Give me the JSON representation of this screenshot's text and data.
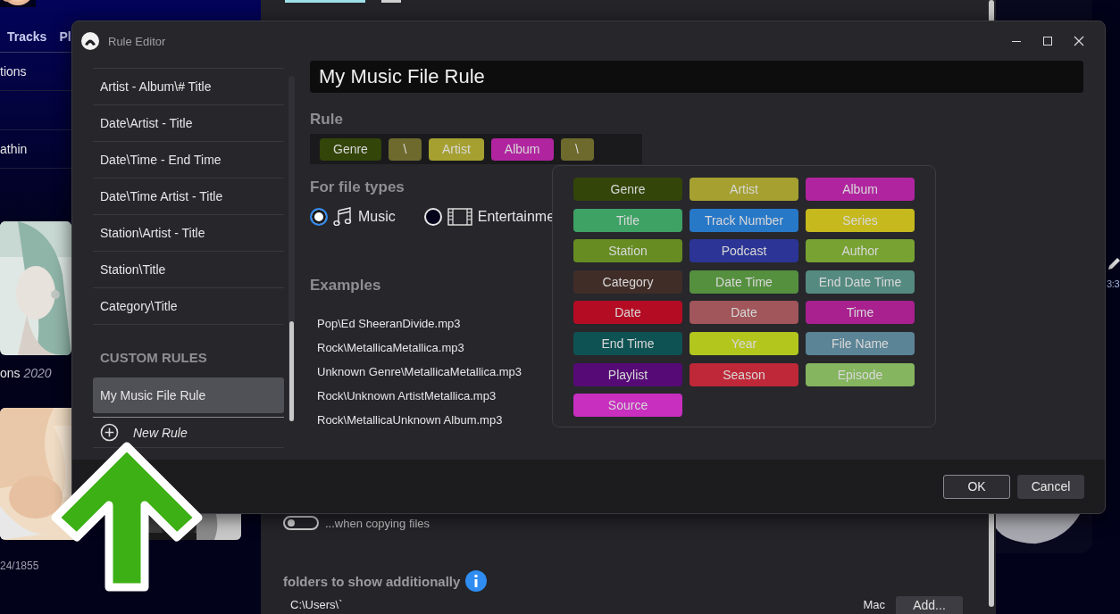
{
  "background_app": {
    "nav_tabs": [
      "Tracks",
      "Pl"
    ],
    "list_items": [
      "tions",
      "athin"
    ],
    "album_caption": {
      "title": "ons",
      "year": "2020"
    },
    "track_count": "24/1855",
    "copy_toggle": {
      "label": "...when copying files",
      "on": false
    },
    "folders": {
      "heading": "folders to show additionally",
      "path": "C:\\Users\\`",
      "column_2": "Mac",
      "add_button": "Add..."
    },
    "time": "3:3"
  },
  "dialog": {
    "title": "Rule Editor",
    "rules": [
      {
        "label": "Artist - Album\\# Title",
        "selected": false
      },
      {
        "label": "Date\\Artist - Title",
        "selected": false
      },
      {
        "label": "Date\\Time - End Time",
        "selected": false
      },
      {
        "label": "Date\\Time Artist - Title",
        "selected": false
      },
      {
        "label": "Station\\Artist - Title",
        "selected": false
      },
      {
        "label": "Station\\Title",
        "selected": false
      },
      {
        "label": "Category\\Title",
        "selected": false
      }
    ],
    "custom_heading": "CUSTOM RULES",
    "custom_rules": [
      {
        "label": "My Music File Rule",
        "selected": true
      }
    ],
    "new_rule": "New Rule",
    "name": "My Music File Rule",
    "rule_heading": "Rule",
    "rule_tokens": [
      {
        "label": "Genre",
        "color": "#334509"
      },
      {
        "label": "\\",
        "color": "#6e6a2e"
      },
      {
        "label": "Artist",
        "color": "#a5a030"
      },
      {
        "label": "Album",
        "color": "#b0259f"
      },
      {
        "label": "\\",
        "color": "#6e6a2e"
      }
    ],
    "file_types_heading": "For file types",
    "file_types": [
      {
        "label": "Music",
        "selected": true,
        "kind": "music"
      },
      {
        "label": "Entertainme",
        "selected": false,
        "kind": "video"
      }
    ],
    "examples_heading": "Examples",
    "examples": [
      "Pop\\Ed SheeranDivide.mp3",
      "Rock\\MetallicaMetallica.mp3",
      "Unknown Genre\\MetallicaMetallica.mp3",
      "Rock\\Unknown ArtistMetallica.mp3",
      "Rock\\MetallicaUnknown Album.mp3"
    ],
    "token_palette": [
      {
        "label": "Genre",
        "color": "#334509"
      },
      {
        "label": "Artist",
        "color": "#a5a030"
      },
      {
        "label": "Album",
        "color": "#b0259f"
      },
      {
        "label": "Title",
        "color": "#3ea265"
      },
      {
        "label": "Track Number",
        "color": "#2878c8"
      },
      {
        "label": "Series",
        "color": "#c6b91e"
      },
      {
        "label": "Station",
        "color": "#668c22"
      },
      {
        "label": "Podcast",
        "color": "#2c3596"
      },
      {
        "label": "Author",
        "color": "#78a232"
      },
      {
        "label": "Category",
        "color": "#412d28"
      },
      {
        "label": "Date Time",
        "color": "#55903f"
      },
      {
        "label": "End Date Time",
        "color": "#558a80"
      },
      {
        "label": "Date",
        "color": "#b40c23"
      },
      {
        "label": "Date",
        "color": "#a0565a"
      },
      {
        "label": "Time",
        "color": "#a9208f"
      },
      {
        "label": "End Time",
        "color": "#0f5253"
      },
      {
        "label": "Year",
        "color": "#b3c61e"
      },
      {
        "label": "File Name",
        "color": "#5b8496"
      },
      {
        "label": "Playlist",
        "color": "#560a76"
      },
      {
        "label": "Season",
        "color": "#bf2838"
      },
      {
        "label": "Episode",
        "color": "#85b55f"
      },
      {
        "label": "Source",
        "color": "#c82fbf"
      }
    ],
    "buttons": [
      "OK",
      "Cancel"
    ]
  }
}
